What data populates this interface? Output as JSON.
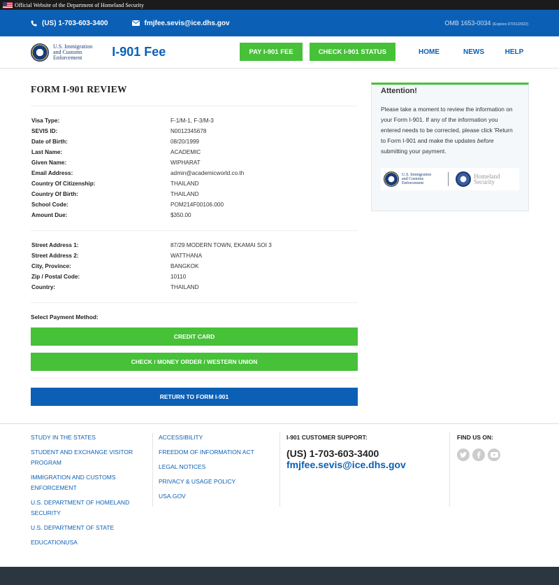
{
  "gov_banner": {
    "text": "Official Website of the Department of Homeland Security"
  },
  "contact": {
    "phone": "(US) 1-703-603-3400",
    "email": "fmjfee.sevis@ice.dhs.gov",
    "omb": "OMB 1653-0034",
    "omb_expires": "(Expires 07/31/2022)"
  },
  "header": {
    "agency_line1": "U.S. Immigration",
    "agency_line2": "and Customs",
    "agency_line3": "Enforcement",
    "brand": "I-901 Fee",
    "nav": {
      "pay": "PAY I-901 FEE",
      "check": "CHECK I-901 STATUS",
      "home": "HOME",
      "news": "NEWS",
      "help": "HELP"
    }
  },
  "main": {
    "title": "FORM I-901 REVIEW",
    "personal": [
      {
        "k": "Visa Type:",
        "v": "F-1/M-1, F-3/M-3"
      },
      {
        "k": "SEVIS ID:",
        "v": "N0012345678"
      },
      {
        "k": "Date of Birth:",
        "v": "08/20/1999"
      },
      {
        "k": "Last Name:",
        "v": "ACADEMIC"
      },
      {
        "k": "Given Name:",
        "v": "WIPHARAT"
      },
      {
        "k": "Email Address:",
        "v": "admin@academicworld.co.th"
      },
      {
        "k": "Country Of Citizenship:",
        "v": "THAILAND"
      },
      {
        "k": "Country Of Birth:",
        "v": "THAILAND"
      },
      {
        "k": "School Code:",
        "v": "POM214F00106.000"
      },
      {
        "k": "Amount Due:",
        "v": "$350.00"
      }
    ],
    "address": [
      {
        "k": "Street Address 1:",
        "v": "87/29 MODERN TOWN, EKAMAI SOI 3"
      },
      {
        "k": "Street Address 2:",
        "v": "WATTHANA"
      },
      {
        "k": "City, Province:",
        "v": "BANGKOK"
      },
      {
        "k": "Zip / Postal Code:",
        "v": "10110"
      },
      {
        "k": "Country:",
        "v": "THAILAND"
      }
    ],
    "payment_label": "Select Payment Method:",
    "credit_card": "CREDIT CARD",
    "check_money": "CHECK / MONEY ORDER / WESTERN UNION",
    "return": "RETURN TO FORM I-901"
  },
  "attention": {
    "title": "Attention!",
    "text_before": "Please take a moment to review the information on your Form I-901. If any of the information you entered needs to be corrected, please click 'Return to Form I-901 and make the updates ",
    "text_em": "before",
    "text_after": " submitting your payment.",
    "logo_ice_1": "U.S. Immigration",
    "logo_ice_2": "and Customs",
    "logo_ice_3": "Enforcement",
    "logo_hs_1": "Homeland",
    "logo_hs_2": "Security"
  },
  "footer": {
    "col1": [
      "STUDY IN THE STATES",
      "STUDENT AND EXCHANGE VISITOR PROGRAM",
      "IMMIGRATION AND CUSTOMS ENFORCEMENT",
      "U.S. DEPARTMENT OF HOMELAND SECURITY",
      "U.S. DEPARTMENT OF STATE",
      "EDUCATIONUSA"
    ],
    "col2": [
      "ACCESSIBILITY",
      "FREEDOM OF INFORMATION ACT",
      "LEGAL NOTICES",
      "PRIVACY & USAGE POLICY",
      "USA.GOV"
    ],
    "support_heading": "I-901 CUSTOMER SUPPORT:",
    "support_phone": "(US) 1-703-603-3400",
    "support_email": "fmjfee.sevis@ice.dhs.gov",
    "find_us": "FIND US ON:",
    "social_icons": [
      "twitter-icon",
      "facebook-icon",
      "youtube-icon"
    ]
  },
  "colors": {
    "primary_blue": "#0b60b5",
    "green": "#46c138",
    "dark_footer": "#2c3640"
  }
}
